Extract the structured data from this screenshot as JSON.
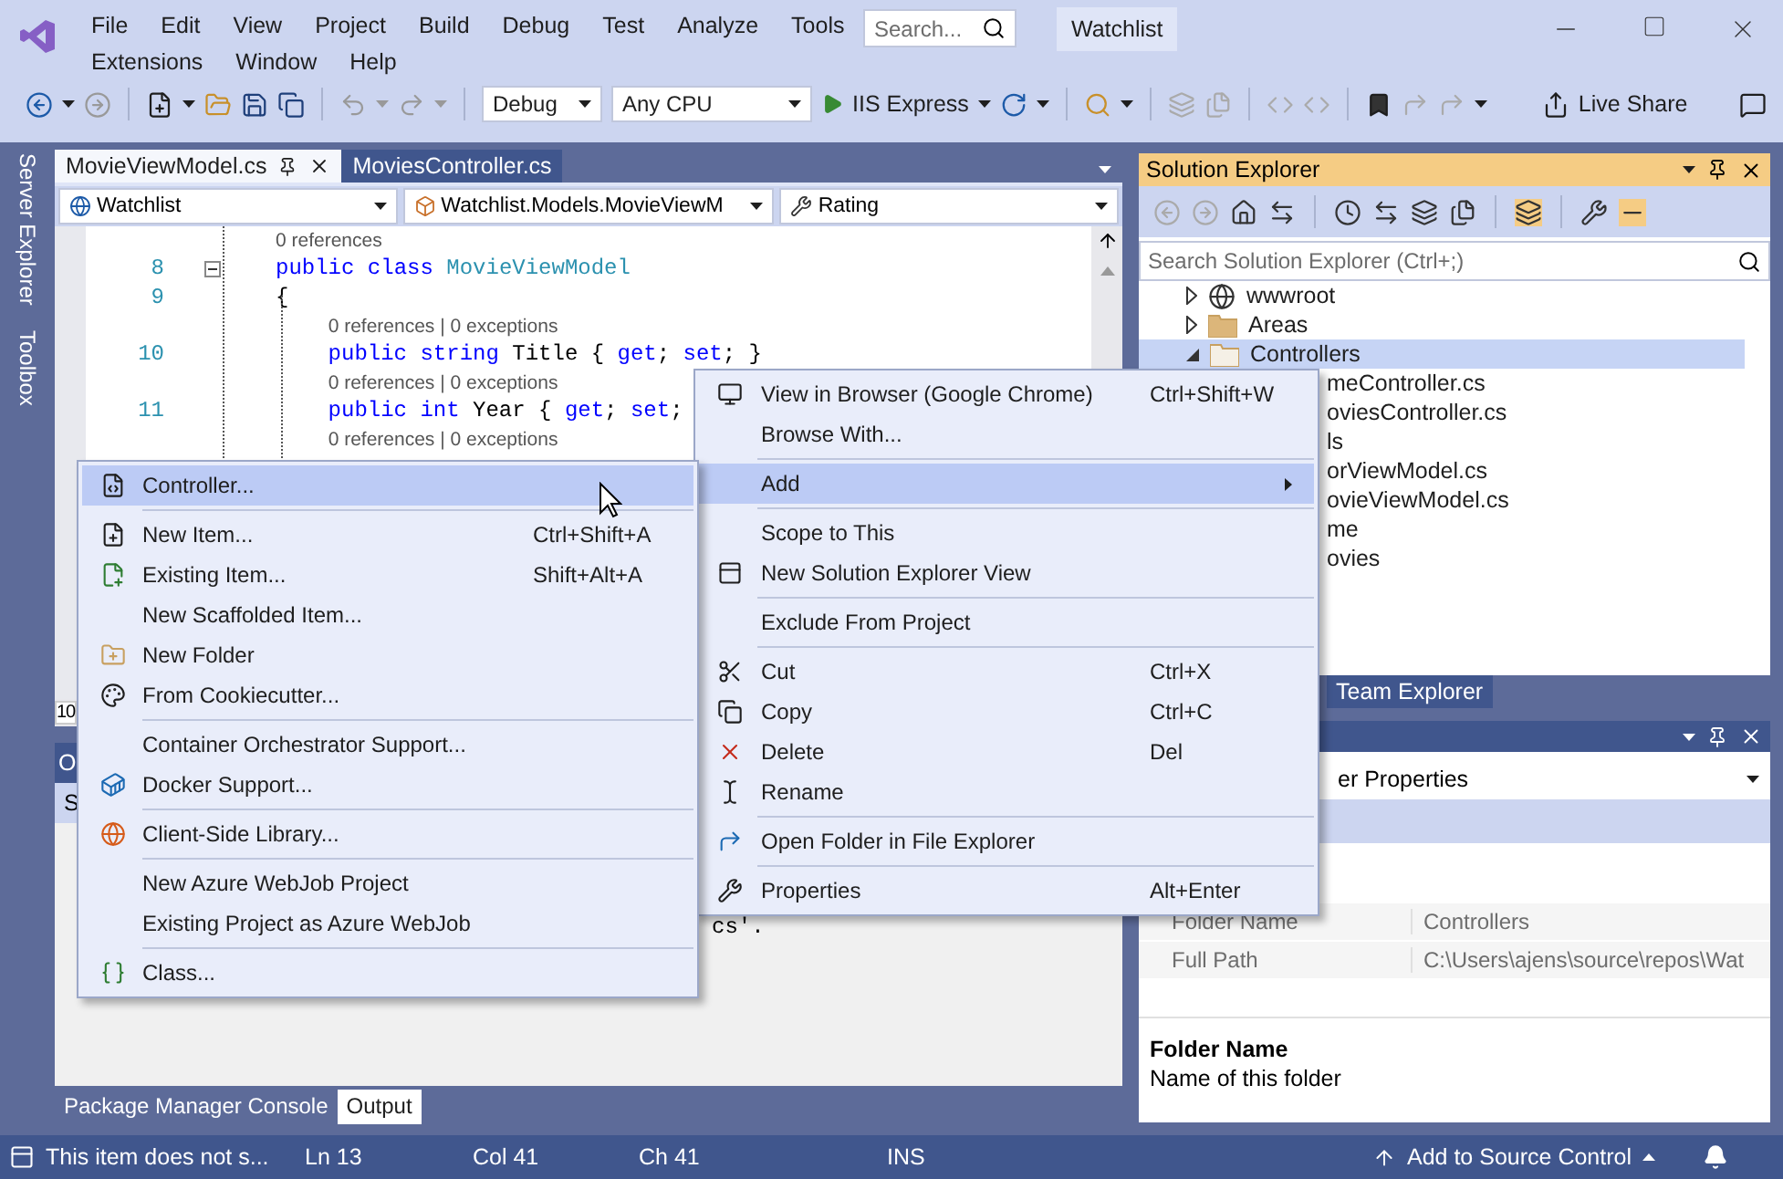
{
  "title_bar": {
    "menu_rows": [
      [
        "File",
        "Edit",
        "View",
        "Project",
        "Build",
        "Debug",
        "Test",
        "Analyze",
        "Tools"
      ],
      [
        "Extensions",
        "Window",
        "Help"
      ]
    ],
    "search": {
      "placeholder": "Search..."
    },
    "solution_name": "Watchlist"
  },
  "toolbar": {
    "configuration": "Debug",
    "platform": "Any CPU",
    "run_target": "IIS Express",
    "live_share": "Live Share"
  },
  "side_strip": [
    "Server Explorer",
    "Toolbox"
  ],
  "editor": {
    "tabs": [
      {
        "label": "MovieViewModel.cs",
        "selected": true
      },
      {
        "label": "MoviesController.cs",
        "selected": false
      }
    ],
    "nav": [
      "Watchlist",
      "Watchlist.Models.MovieViewM",
      "Rating"
    ],
    "lines": [
      {
        "kind": "lens",
        "text": "0 references"
      },
      {
        "kind": "code",
        "number": "8",
        "fold": true,
        "tokens": [
          {
            "kind": "keyword",
            "text": "public"
          },
          {
            "kind": "keyword",
            "text": " class"
          },
          {
            "kind": "type",
            "text": " MovieViewModel"
          }
        ]
      },
      {
        "kind": "code",
        "number": "9",
        "tokens": [
          {
            "kind": "plain",
            "text": "{"
          }
        ]
      },
      {
        "kind": "lens",
        "text": "    0 references | 0 exceptions"
      },
      {
        "kind": "code",
        "number": "10",
        "tokens": [
          {
            "kind": "keyword",
            "text": "    public"
          },
          {
            "kind": "keyword",
            "text": " string"
          },
          {
            "kind": "plain",
            "text": " Title { "
          },
          {
            "kind": "keyword",
            "text": "get"
          },
          {
            "kind": "plain",
            "text": "; "
          },
          {
            "kind": "keyword",
            "text": "set"
          },
          {
            "kind": "plain",
            "text": "; }"
          }
        ]
      },
      {
        "kind": "lens",
        "text": "    0 references | 0 exceptions"
      },
      {
        "kind": "code",
        "number": "11",
        "tokens": [
          {
            "kind": "keyword",
            "text": "    public"
          },
          {
            "kind": "keyword",
            "text": " int"
          },
          {
            "kind": "plain",
            "text": " Year { "
          },
          {
            "kind": "keyword",
            "text": "get"
          },
          {
            "kind": "plain",
            "text": "; "
          },
          {
            "kind": "keyword",
            "text": "set"
          },
          {
            "kind": "plain",
            "text": ";"
          }
        ]
      },
      {
        "kind": "lens",
        "text": "    0 references | 0 exceptions"
      }
    ],
    "zoom_fragment": "10"
  },
  "output": {
    "header_fragment": "O",
    "toolbar_fragment": "S",
    "text_fragment": "cs'."
  },
  "bottom_tabs": [
    {
      "label": "Package Manager Console",
      "selected": false
    },
    {
      "label": "Output",
      "selected": true
    }
  ],
  "solution_explorer": {
    "title": "Solution Explorer",
    "search": {
      "placeholder": "Search Solution Explorer (Ctrl+;)"
    },
    "tree": [
      {
        "label": "wwwroot",
        "kind": "web",
        "expanded": false,
        "selected": false
      },
      {
        "label": "Areas",
        "kind": "folder",
        "expanded": false,
        "selected": false
      },
      {
        "label": "Controllers",
        "kind": "folder",
        "expanded": true,
        "selected": true,
        "children": [
          {
            "label": "meController.cs",
            "kind": "clipped",
            "selected": false
          },
          {
            "label": "oviesController.cs",
            "kind": "clipped",
            "selected": false
          }
        ]
      },
      {
        "label": "ls",
        "kind": "clipped",
        "selected": false,
        "children": [
          {
            "label": "orViewModel.cs",
            "kind": "clipped",
            "selected": false
          },
          {
            "label": "ovieViewModel.cs",
            "kind": "clipped",
            "selected": false
          }
        ]
      },
      {
        "label": "me",
        "kind": "clipped",
        "selected": false
      },
      {
        "label": "ovies",
        "kind": "clipped",
        "selected": false
      }
    ]
  },
  "team_explorer_tab": "Team Explorer",
  "properties": {
    "object": "er Properties",
    "rows": [
      {
        "name": "Folder Name",
        "value": "Controllers"
      },
      {
        "name": "Full Path",
        "value": "C:\\Users\\ajens\\source\\repos\\Wat"
      }
    ],
    "description_title": "Folder Name",
    "description": "Name of this folder"
  },
  "context_menu": {
    "items": [
      {
        "kind": "item",
        "label": "View in Browser (Google Chrome)",
        "shortcut": "Ctrl+Shift+W",
        "selected": false
      },
      {
        "kind": "item",
        "label": "Browse With...",
        "selected": false
      },
      {
        "kind": "separator"
      },
      {
        "kind": "submenu",
        "label": "Add",
        "selected": true
      },
      {
        "kind": "separator"
      },
      {
        "kind": "item",
        "label": "Scope to This",
        "selected": false
      },
      {
        "kind": "item",
        "label": "New Solution Explorer View",
        "selected": false
      },
      {
        "kind": "separator"
      },
      {
        "kind": "item",
        "label": "Exclude From Project",
        "selected": false
      },
      {
        "kind": "separator"
      },
      {
        "kind": "item",
        "label": "Cut",
        "shortcut": "Ctrl+X",
        "selected": false
      },
      {
        "kind": "item",
        "label": "Copy",
        "shortcut": "Ctrl+C",
        "selected": false
      },
      {
        "kind": "item",
        "label": "Delete",
        "shortcut": "Del",
        "selected": false
      },
      {
        "kind": "item",
        "label": "Rename",
        "selected": false
      },
      {
        "kind": "separator"
      },
      {
        "kind": "item",
        "label": "Open Folder in File Explorer",
        "selected": false
      },
      {
        "kind": "separator"
      },
      {
        "kind": "item",
        "label": "Properties",
        "shortcut": "Alt+Enter",
        "selected": false
      }
    ]
  },
  "add_submenu": {
    "items": [
      {
        "kind": "item",
        "label": "Controller...",
        "selected": true
      },
      {
        "kind": "separator"
      },
      {
        "kind": "item",
        "label": "New Item...",
        "shortcut": "Ctrl+Shift+A",
        "selected": false
      },
      {
        "kind": "item",
        "label": "Existing Item...",
        "shortcut": "Shift+Alt+A",
        "selected": false
      },
      {
        "kind": "item",
        "label": "New Scaffolded Item...",
        "selected": false
      },
      {
        "kind": "item",
        "label": "New Folder",
        "selected": false
      },
      {
        "kind": "item",
        "label": "From Cookiecutter...",
        "selected": false
      },
      {
        "kind": "separator"
      },
      {
        "kind": "item",
        "label": "Container Orchestrator Support...",
        "selected": false
      },
      {
        "kind": "item",
        "label": "Docker Support...",
        "selected": false
      },
      {
        "kind": "separator"
      },
      {
        "kind": "item",
        "label": "Client-Side Library...",
        "selected": false
      },
      {
        "kind": "separator"
      },
      {
        "kind": "item",
        "label": "New Azure WebJob Project",
        "selected": false
      },
      {
        "kind": "item",
        "label": "Existing Project as Azure WebJob",
        "selected": false
      },
      {
        "kind": "separator"
      },
      {
        "kind": "item",
        "label": "Class...",
        "selected": false
      }
    ]
  },
  "status_bar": {
    "message": "This item does not s...",
    "line": "Ln 13",
    "column": "Col 41",
    "char": "Ch 41",
    "mode": "INS",
    "source_control": "Add to Source Control"
  }
}
